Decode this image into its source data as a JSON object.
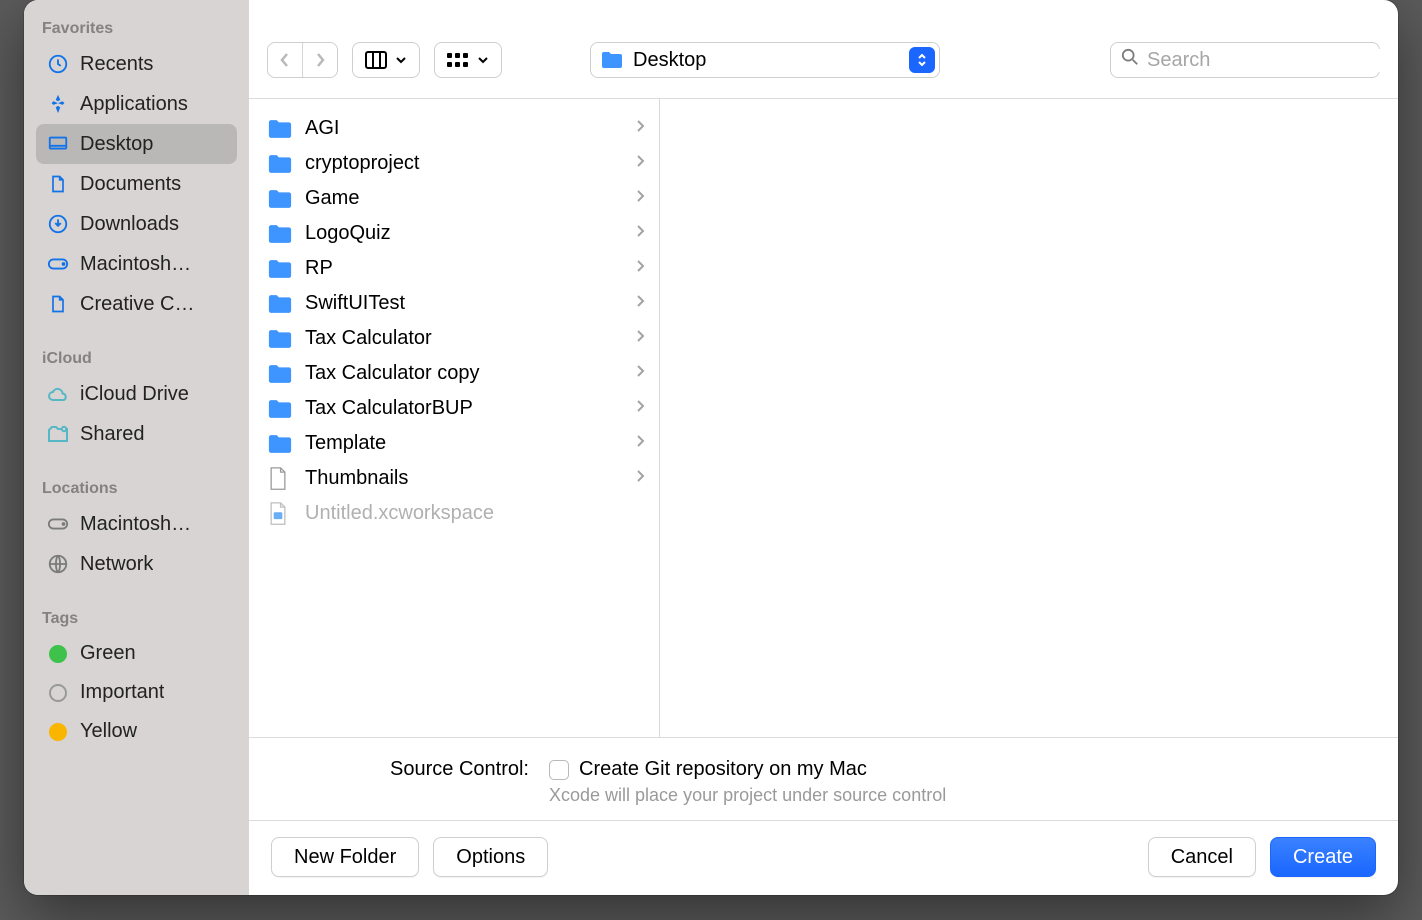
{
  "sidebar": {
    "favorites_label": "Favorites",
    "icloud_label": "iCloud",
    "locations_label": "Locations",
    "tags_label": "Tags",
    "favorites": [
      {
        "label": "Recents"
      },
      {
        "label": "Applications"
      },
      {
        "label": "Desktop",
        "selected": true
      },
      {
        "label": "Documents"
      },
      {
        "label": "Downloads"
      },
      {
        "label": "Macintosh…"
      },
      {
        "label": "Creative C…"
      }
    ],
    "icloud": [
      {
        "label": "iCloud Drive"
      },
      {
        "label": "Shared"
      }
    ],
    "locations": [
      {
        "label": "Macintosh…"
      },
      {
        "label": "Network"
      }
    ],
    "tags": [
      {
        "label": "Green",
        "color": "green"
      },
      {
        "label": "Important",
        "color": "clear"
      },
      {
        "label": "Yellow",
        "color": "yellow"
      }
    ]
  },
  "toolbar": {
    "location_name": "Desktop",
    "search_placeholder": "Search"
  },
  "files": [
    {
      "name": "AGI",
      "type": "folder"
    },
    {
      "name": "cryptoproject",
      "type": "folder"
    },
    {
      "name": "Game",
      "type": "folder"
    },
    {
      "name": "LogoQuiz",
      "type": "folder"
    },
    {
      "name": "RP",
      "type": "folder"
    },
    {
      "name": "SwiftUITest",
      "type": "folder"
    },
    {
      "name": "Tax Calculator",
      "type": "folder"
    },
    {
      "name": "Tax Calculator copy",
      "type": "folder"
    },
    {
      "name": "Tax CalculatorBUP",
      "type": "folder"
    },
    {
      "name": "Template",
      "type": "folder"
    },
    {
      "name": "Thumbnails",
      "type": "folder-file"
    },
    {
      "name": "Untitled.xcworkspace",
      "type": "file",
      "dim": true
    }
  ],
  "source_control": {
    "lead": "Source Control:",
    "checkbox_label": "Create Git repository on my Mac",
    "hint": "Xcode will place your project under source control"
  },
  "footer": {
    "new_folder": "New Folder",
    "options": "Options",
    "cancel": "Cancel",
    "create": "Create"
  }
}
